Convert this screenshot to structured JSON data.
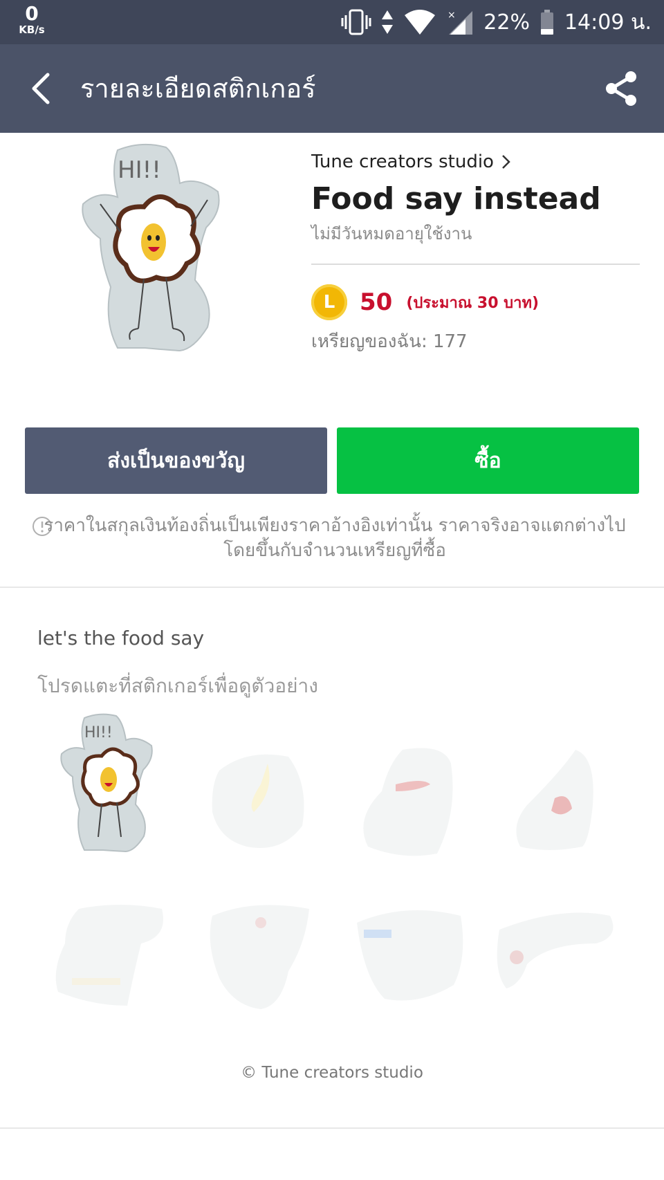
{
  "status_bar": {
    "net_speed": "0",
    "net_unit": "KB/s",
    "battery": "22%",
    "time": "14:09 น."
  },
  "header": {
    "title": "รายละเอียดสติกเกอร์"
  },
  "pack": {
    "creator": "Tune creators studio",
    "title": "Food say instead",
    "expiry": "ไม่มีวันหมดอายุใช้งาน",
    "coin_label": "L",
    "price": "50",
    "price_approx": "(ประมาณ 30 บาท)",
    "my_coins": "เหรียญของฉัน: 177"
  },
  "buttons": {
    "gift": "ส่งเป็นของขวัญ",
    "buy": "ซื้อ"
  },
  "disclaimer": "ราคาในสกุลเงินท้องถิ่นเป็นเพียงราคาอ้างอิงเท่านั้น ราคาจริงอาจแตกต่างไปโดยขึ้นกับจำนวนเหรียญที่ซื้อ",
  "description": "let's the food say",
  "preview_hint": "โปรดแตะที่สติกเกอร์เพื่อดูตัวอย่าง",
  "hero_text": "HI!!",
  "copyright": "© Tune creators studio",
  "colors": {
    "status_bar": "#3f4659",
    "header": "#4b5368",
    "gift_button": "#525b73",
    "buy_button": "#06c143",
    "price": "#c8102e",
    "coin": "#f2b705"
  }
}
